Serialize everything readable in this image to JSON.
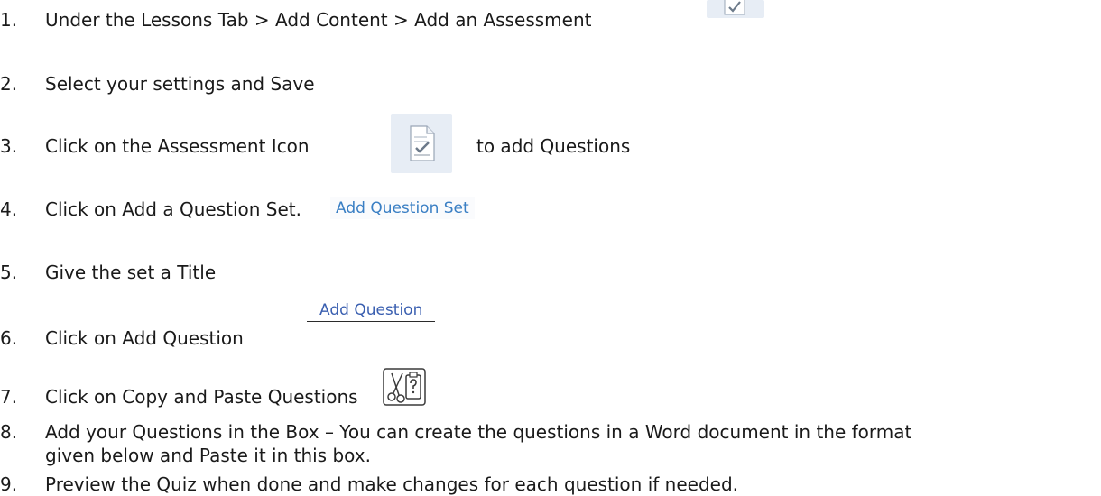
{
  "steps": [
    {
      "num": "1.",
      "text": "Under the Lessons Tab > Add Content > Add an Assessment"
    },
    {
      "num": "2.",
      "text": "Select your settings and Save"
    },
    {
      "num": "3.",
      "text": "Click on the  Assessment  Icon",
      "after": "to add Questions"
    },
    {
      "num": "4.",
      "text": "Click on Add a Question Set."
    },
    {
      "num": "5.",
      "text": "Give the set a Title"
    },
    {
      "num": "6.",
      "text": "Click on Add  Question"
    },
    {
      "num": "7.",
      "text": "Click on  Copy and Paste Questions"
    },
    {
      "num": "8.",
      "text": "Add your Questions in the Box – You can create the questions in a Word document in the format",
      "continuation": "given below and Paste it in this box."
    },
    {
      "num": "9.",
      "text": "Preview the Quiz when done and make changes for each question if needed."
    }
  ],
  "buttons": {
    "add_question_set": "Add Question Set",
    "add_question": "Add Question"
  },
  "icons": {
    "assessment": "assessment-icon",
    "copy_paste": "copy-paste-questions-icon"
  },
  "colors": {
    "link_blue": "#3a7fc4",
    "icon_bg": "#e7edf5"
  }
}
